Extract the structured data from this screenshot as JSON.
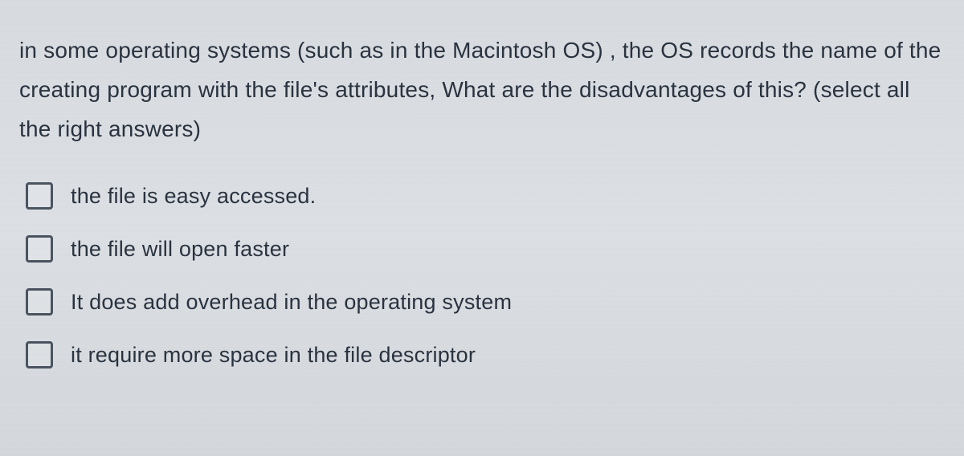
{
  "question": "in some operating systems (such as in the Macintosh OS) , the OS records the name of the creating program with the file's attributes, What are the disadvantages of this? (select all the right answers)",
  "options": [
    {
      "label": "the file is easy accessed.",
      "checked": false
    },
    {
      "label": "the file will open faster",
      "checked": false
    },
    {
      "label": "It does add overhead in the operating system",
      "checked": false
    },
    {
      "label": "it require more space in the file descriptor",
      "checked": false
    }
  ]
}
